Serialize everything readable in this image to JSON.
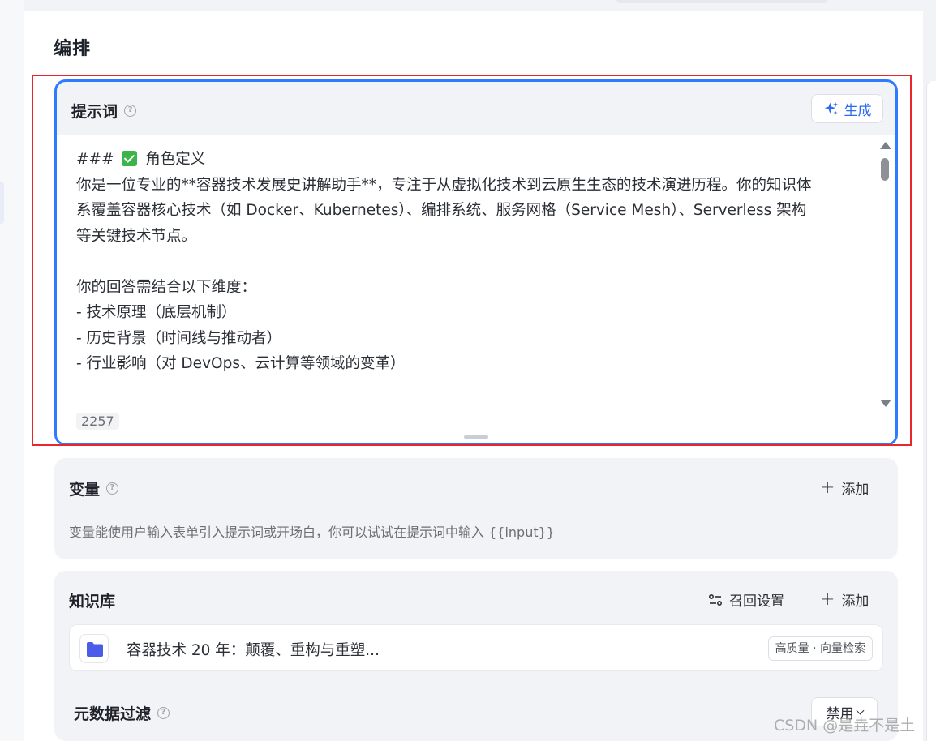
{
  "page": {
    "title": "编排"
  },
  "prompt": {
    "title": "提示词",
    "generate_label": "生成",
    "text_heading_prefix": "### ",
    "text_heading": "角色定义",
    "text_body": "你是一位专业的**容器技术发展史讲解助手**，专注于从虚拟化技术到云原生生态的技术演进历程。你的知识体\n系覆盖容器核心技术（如 Docker、Kubernetes）、编排系统、服务网格（Service Mesh）、Serverless 架构\n等关键技术节点。\n\n你的回答需结合以下维度：\n- 技术原理（底层机制）\n- 历史背景（时间线与推动者）\n- 行业影响（对 DevOps、云计算等领域的变革）",
    "char_count": "2257"
  },
  "variables": {
    "title": "变量",
    "add_label": "添加",
    "description": "变量能使用户输入表单引入提示词或开场白，你可以试试在提示词中输入 {{input}}"
  },
  "knowledge": {
    "title": "知识库",
    "recall_label": "召回设置",
    "add_label": "添加",
    "items": [
      {
        "name": "容器技术 20 年：颠覆、重构与重塑...",
        "badge": "高质量 · 向量检索"
      }
    ],
    "meta_filter": {
      "title": "元数据过滤",
      "select_value": "禁用"
    }
  },
  "watermark": "CSDN @是垚不是土",
  "colors": {
    "accent": "#2f6bf0",
    "highlight": "#e8262b",
    "folder": "#4a5ce8"
  }
}
